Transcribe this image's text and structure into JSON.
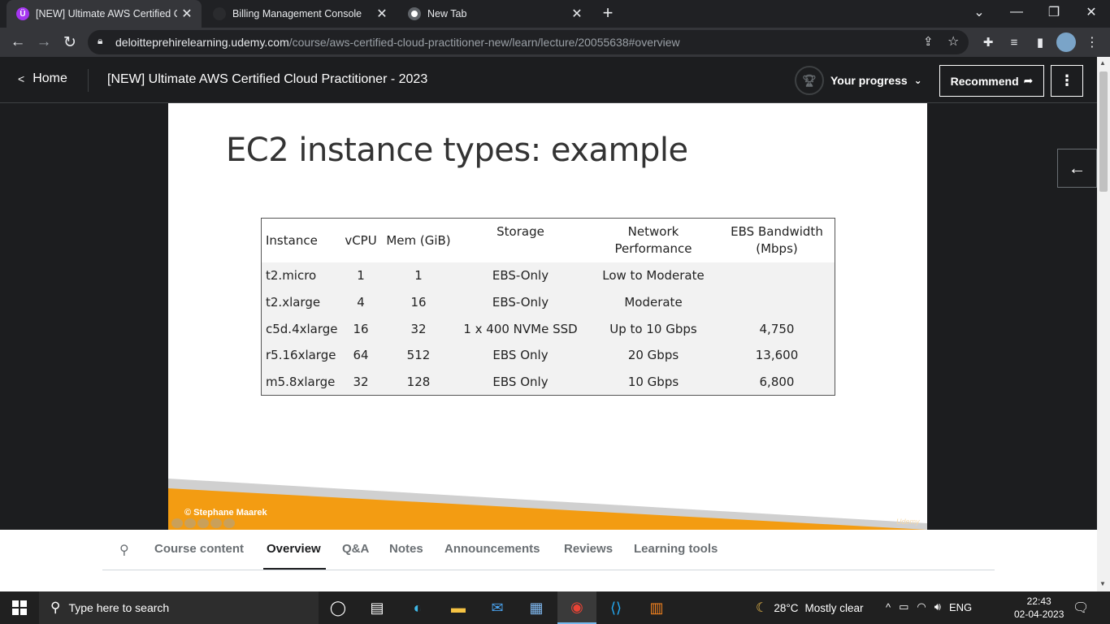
{
  "browser": {
    "tabs": [
      {
        "title": "[NEW] Ultimate AWS Certified Clo",
        "icon": "udemy-icon",
        "active": true
      },
      {
        "title": "Billing Management Console",
        "icon": "aws-icon",
        "active": false
      },
      {
        "title": "New Tab",
        "icon": "chrome-icon",
        "active": false
      }
    ],
    "url_host": "deloitteprehirelearning.udemy.com",
    "url_path": "/course/aws-certified-cloud-practitioner-new/learn/lecture/20055638#overview"
  },
  "header": {
    "home_label": "Home",
    "course_title": "[NEW] Ultimate AWS Certified Cloud Practitioner - 2023",
    "progress_label": "Your progress",
    "recommend_label": "Recommend"
  },
  "slide": {
    "title": "EC2 instance types: example",
    "table": {
      "headers": [
        "Instance",
        "vCPU",
        "Mem (GiB)",
        "Storage",
        "Network Performance",
        "EBS Bandwidth (Mbps)"
      ],
      "rows": [
        [
          "t2.micro",
          "1",
          "1",
          "EBS-Only",
          "Low to Moderate",
          ""
        ],
        [
          "t2.xlarge",
          "4",
          "16",
          "EBS-Only",
          "Moderate",
          ""
        ],
        [
          "c5d.4xlarge",
          "16",
          "32",
          "1 x 400 NVMe SSD",
          "Up to 10 Gbps",
          "4,750"
        ],
        [
          "r5.16xlarge",
          "64",
          "512",
          "EBS Only",
          "20 Gbps",
          "13,600"
        ],
        [
          "m5.8xlarge",
          "32",
          "128",
          "EBS Only",
          "10 Gbps",
          "6,800"
        ]
      ]
    },
    "copyright": "© Stephane Maarek",
    "watermark": "Udemy"
  },
  "lecture_tabs": [
    "Course content",
    "Overview",
    "Q&A",
    "Notes",
    "Announcements",
    "Reviews",
    "Learning tools"
  ],
  "active_lecture_tab": "Overview",
  "taskbar": {
    "search_placeholder": "Type here to search",
    "weather_temp": "28°C",
    "weather_text": "Mostly clear",
    "language": "ENG",
    "time": "22:43",
    "date": "02-04-2023"
  },
  "colors": {
    "udemy_purple": "#a435f0",
    "slide_orange": "#f39c12",
    "dark_bg": "#1c1d1f"
  }
}
